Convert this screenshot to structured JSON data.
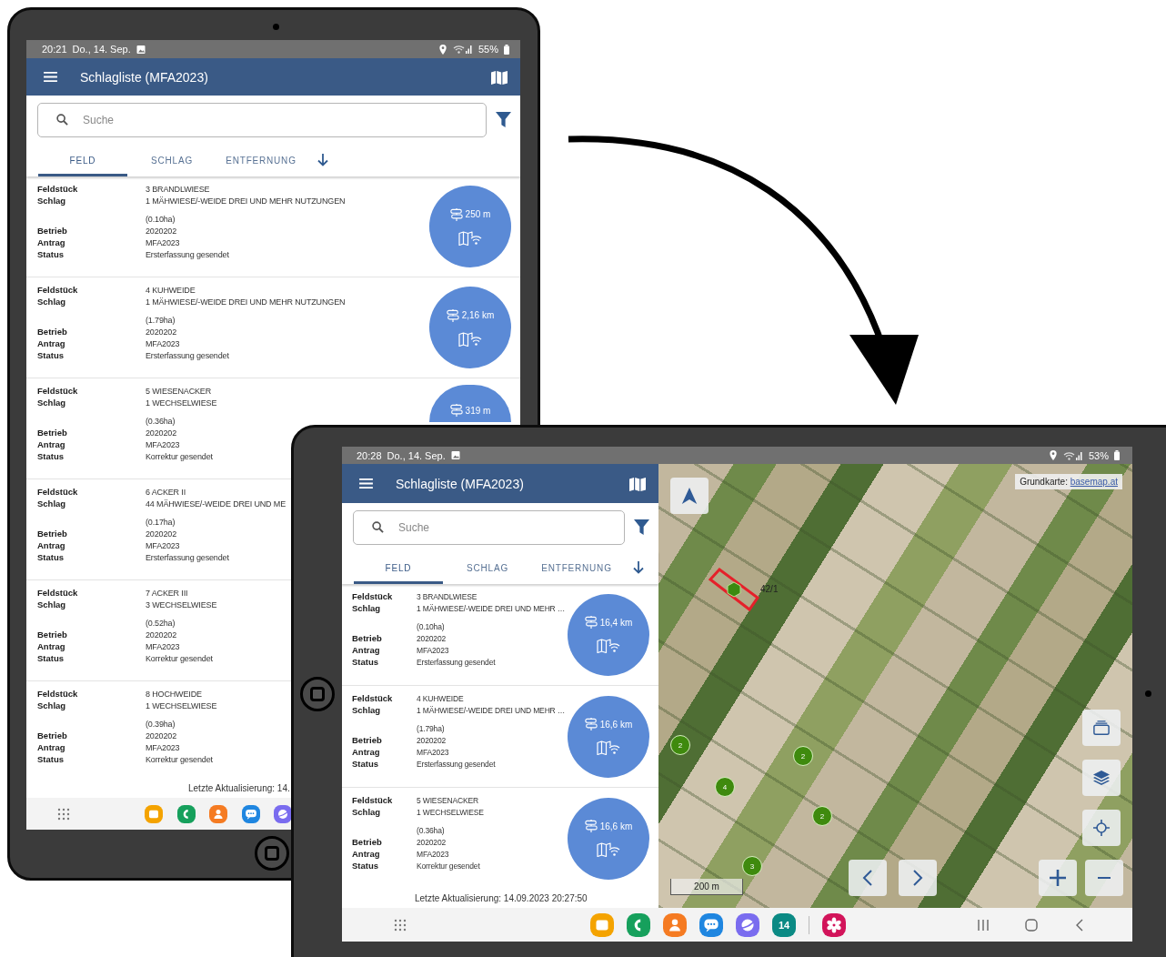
{
  "left_tablet": {
    "status_bar": {
      "time": "20:21",
      "date": "Do., 14. Sep.",
      "battery": "55%"
    },
    "app_bar": {
      "title": "Schlagliste (MFA2023)"
    },
    "search": {
      "placeholder": "Suche"
    },
    "sort_tabs": [
      {
        "label": "FELD",
        "selected": true
      },
      {
        "label": "SCHLAG",
        "selected": false
      },
      {
        "label": "ENTFERNUNG",
        "selected": false
      }
    ],
    "entries": [
      {
        "rows": [
          {
            "label": "Feldstück",
            "value": "3 BRANDLWIESE"
          },
          {
            "label": "Schlag",
            "value": "1 MÄHWIESE/-WEIDE DREI UND MEHR NUTZUNGEN"
          },
          {
            "value": "(0.10ha)"
          },
          {
            "label": "Betrieb",
            "value": "2020202"
          },
          {
            "label": "Antrag",
            "value": "MFA2023"
          },
          {
            "label": "Status",
            "value": "Ersterfassung gesendet"
          }
        ],
        "distance": "250 m"
      },
      {
        "rows": [
          {
            "label": "Feldstück",
            "value": "4 KUHWEIDE"
          },
          {
            "label": "Schlag",
            "value": "1 MÄHWIESE/-WEIDE DREI UND MEHR NUTZUNGEN"
          },
          {
            "value": "(1.79ha)"
          },
          {
            "label": "Betrieb",
            "value": "2020202"
          },
          {
            "label": "Antrag",
            "value": "MFA2023"
          },
          {
            "label": "Status",
            "value": "Ersterfassung gesendet"
          }
        ],
        "distance": "2,16 km"
      },
      {
        "rows": [
          {
            "label": "Feldstück",
            "value": "5 WIESENACKER"
          },
          {
            "label": "Schlag",
            "value": "1 WECHSELWIESE"
          },
          {
            "value": "(0.36ha)"
          },
          {
            "label": "Betrieb",
            "value": "2020202"
          },
          {
            "label": "Antrag",
            "value": "MFA2023"
          },
          {
            "label": "Status",
            "value": "Korrektur gesendet"
          }
        ],
        "distance": "319 m"
      },
      {
        "rows": [
          {
            "label": "Feldstück",
            "value": "6 ACKER II"
          },
          {
            "label": "Schlag",
            "value": "44 MÄHWIESE/-WEIDE DREI UND ME"
          },
          {
            "value": "(0.17ha)"
          },
          {
            "label": "Betrieb",
            "value": "2020202"
          },
          {
            "label": "Antrag",
            "value": "MFA2023"
          },
          {
            "label": "Status",
            "value": "Ersterfassung gesendet"
          }
        ]
      },
      {
        "rows": [
          {
            "label": "Feldstück",
            "value": "7 ACKER III"
          },
          {
            "label": "Schlag",
            "value": "3 WECHSELWIESE"
          },
          {
            "value": "(0.52ha)"
          },
          {
            "label": "Betrieb",
            "value": "2020202"
          },
          {
            "label": "Antrag",
            "value": "MFA2023"
          },
          {
            "label": "Status",
            "value": "Korrektur gesendet"
          }
        ]
      },
      {
        "rows": [
          {
            "label": "Feldstück",
            "value": "8 HOCHWEIDE"
          },
          {
            "label": "Schlag",
            "value": "1 WECHSELWIESE"
          },
          {
            "value": "(0.39ha)"
          },
          {
            "label": "Betrieb",
            "value": "2020202"
          },
          {
            "label": "Antrag",
            "value": "MFA2023"
          },
          {
            "label": "Status",
            "value": "Korrektur gesendet"
          }
        ]
      }
    ],
    "footer": "Letzte Aktualisierung: 14.",
    "dock": {
      "apps": [
        {
          "kind": "files"
        },
        {
          "kind": "phone"
        },
        {
          "kind": "contacts"
        },
        {
          "kind": "messages"
        },
        {
          "kind": "internet"
        }
      ]
    }
  },
  "right_tablet": {
    "status_bar": {
      "time": "20:28",
      "date": "Do., 14. Sep.",
      "battery": "53%"
    },
    "app_bar": {
      "title": "Schlagliste (MFA2023)"
    },
    "search": {
      "placeholder": "Suche"
    },
    "sort_tabs": [
      {
        "label": "FELD",
        "selected": true
      },
      {
        "label": "SCHLAG",
        "selected": false
      },
      {
        "label": "ENTFERNUNG",
        "selected": false
      }
    ],
    "entries": [
      {
        "rows": [
          {
            "label": "Feldstück",
            "value": "3 BRANDLWIESE"
          },
          {
            "label": "Schlag",
            "value": "1 MÄHWIESE/-WEIDE DREI UND MEHR …"
          },
          {
            "value": "(0.10ha)"
          },
          {
            "label": "Betrieb",
            "value": "2020202"
          },
          {
            "label": "Antrag",
            "value": "MFA2023"
          },
          {
            "label": "Status",
            "value": "Ersterfassung gesendet"
          }
        ],
        "distance": "16,4 km"
      },
      {
        "rows": [
          {
            "label": "Feldstück",
            "value": "4 KUHWEIDE"
          },
          {
            "label": "Schlag",
            "value": "1 MÄHWIESE/-WEIDE DREI UND MEHR …"
          },
          {
            "value": "(1.79ha)"
          },
          {
            "label": "Betrieb",
            "value": "2020202"
          },
          {
            "label": "Antrag",
            "value": "MFA2023"
          },
          {
            "label": "Status",
            "value": "Ersterfassung gesendet"
          }
        ],
        "distance": "16,6 km"
      },
      {
        "rows": [
          {
            "label": "Feldstück",
            "value": "5 WIESENACKER"
          },
          {
            "label": "Schlag",
            "value": "1 WECHSELWIESE"
          },
          {
            "value": "(0.36ha)"
          },
          {
            "label": "Betrieb",
            "value": "2020202"
          },
          {
            "label": "Antrag",
            "value": "MFA2023"
          },
          {
            "label": "Status",
            "value": "Korrektur gesendet"
          }
        ],
        "distance": "16,6 km"
      }
    ],
    "footer": "Letzte Aktualisierung: 14.09.2023 20:27:50",
    "map": {
      "attribution": {
        "text": "Grundkarte:",
        "link": "basemap.at"
      },
      "field_label": "42/1",
      "clusters": [
        "2",
        "2",
        "4",
        "2",
        "3"
      ],
      "scale": "200 m"
    },
    "dock": {
      "apps": [
        {
          "kind": "files"
        },
        {
          "kind": "phone"
        },
        {
          "kind": "contacts"
        },
        {
          "kind": "messages"
        },
        {
          "kind": "internet"
        },
        {
          "kind": "calendar",
          "label": "14"
        },
        {
          "kind": "separator"
        },
        {
          "kind": "gallery"
        }
      ]
    }
  }
}
